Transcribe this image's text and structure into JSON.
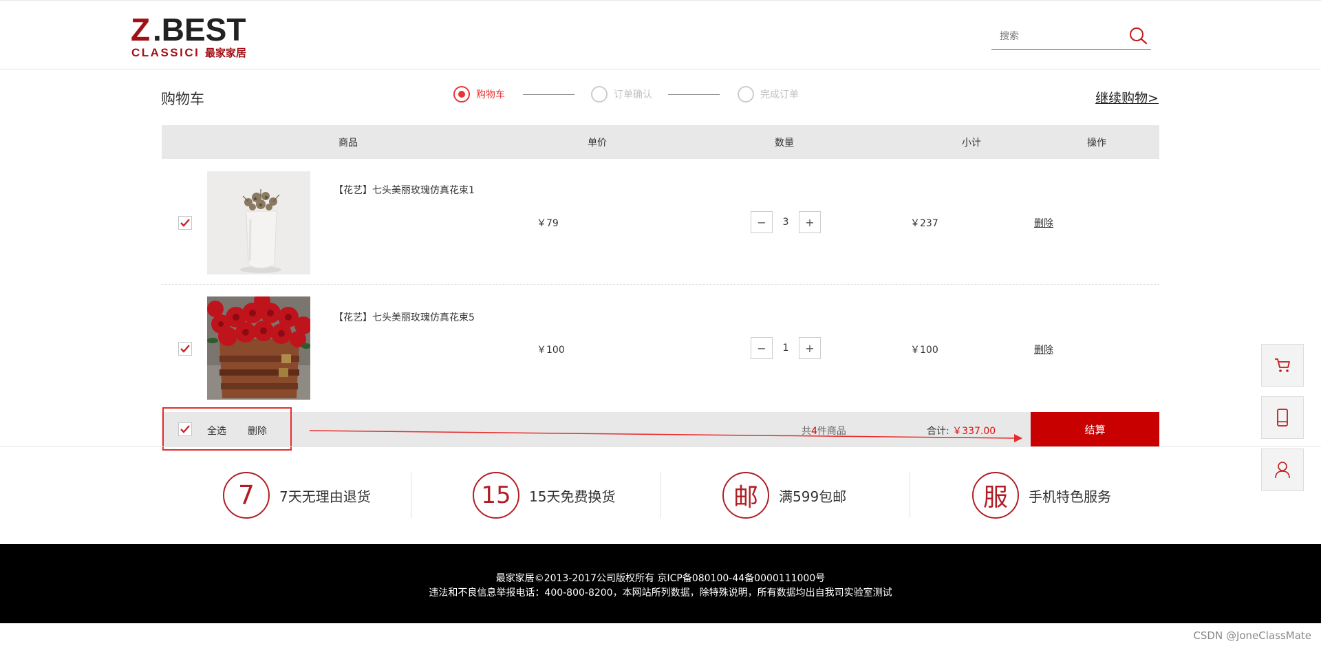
{
  "brand": {
    "logo_top": "Z.BEST",
    "logo_sub_en": "CLASSICI",
    "logo_sub_cn": "最家家居",
    "colors": {
      "red": "#b01e24",
      "accent": "#e83434",
      "checkout": "#c80000"
    }
  },
  "header": {
    "search_placeholder": "搜索",
    "search_icon": "search-icon"
  },
  "cart": {
    "title": "购物车",
    "steps": [
      {
        "label": "购物车",
        "state": "active"
      },
      {
        "label": "订单确认",
        "state": "inactive"
      },
      {
        "label": "完成订单",
        "state": "inactive"
      }
    ],
    "continue_label": "继续购物>",
    "columns": [
      "商品",
      "单价",
      "数量",
      "小计",
      "操作"
    ],
    "items": [
      {
        "name": "【花艺】七头美丽玫瑰仿真花束1",
        "price": "￥79",
        "qty": "3",
        "subtotal": "￥237",
        "delete_label": "删除",
        "checked": true
      },
      {
        "name": "【花艺】七头美丽玫瑰仿真花束5",
        "price": "￥100",
        "qty": "1",
        "subtotal": "￥100",
        "delete_label": "删除",
        "checked": true
      }
    ],
    "footer": {
      "select_all_label": "全选",
      "delete_label": "删除",
      "count_prefix": "共",
      "count_value": "4",
      "count_suffix": "件商品",
      "total_label": "合计:",
      "total_value": "￥337.00",
      "checkout_label": "结算"
    }
  },
  "services": [
    {
      "glyph": "7",
      "text": "7天无理由退货"
    },
    {
      "glyph": "15",
      "text": "15天免费换货"
    },
    {
      "glyph": "邮",
      "text": "满599包邮"
    },
    {
      "glyph": "服",
      "text": "手机特色服务"
    }
  ],
  "footer": {
    "line1": "最家家居©2013-2017公司版权所有 京ICP备080100-44备0000111000号",
    "line2": "违法和不良信息举报电话：400-800-8200，本网站所列数据，除特殊说明，所有数据均出自我司实验室测试"
  },
  "side_tools": [
    "cart-icon",
    "phone-icon",
    "user-icon"
  ],
  "watermark": "CSDN @JoneClassMate"
}
